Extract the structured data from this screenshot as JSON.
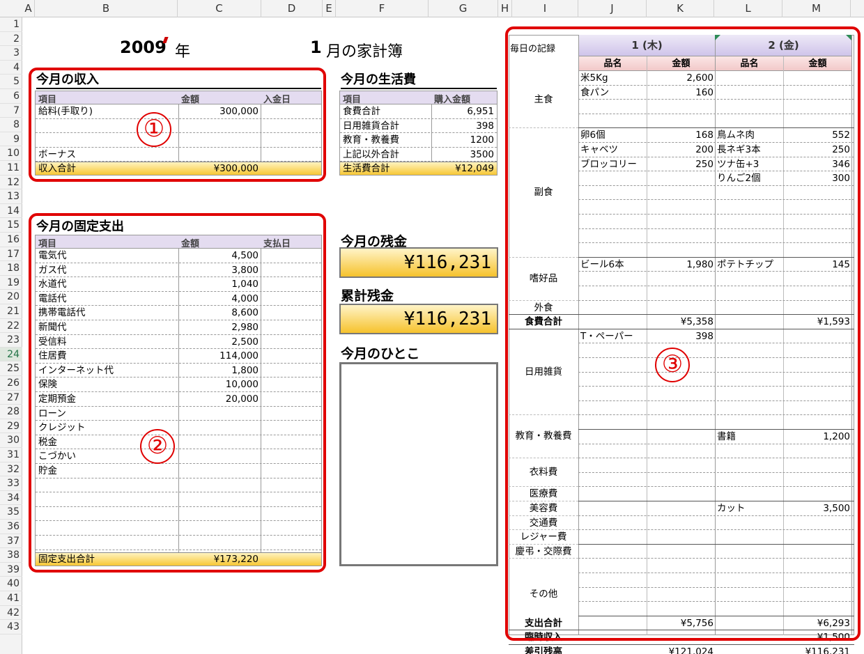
{
  "spreadsheet": {
    "columns": [
      "A",
      "B",
      "C",
      "D",
      "E",
      "F",
      "G",
      "H",
      "I",
      "J",
      "K",
      "L",
      "M"
    ],
    "rows": [
      "1",
      "2",
      "3",
      "4",
      "5",
      "6",
      "7",
      "8",
      "9",
      "10",
      "11",
      "12",
      "13",
      "14",
      "15",
      "16",
      "17",
      "18",
      "19",
      "20",
      "21",
      "22",
      "23",
      "24",
      "25",
      "26",
      "27",
      "28",
      "29",
      "30",
      "31",
      "32",
      "33",
      "34",
      "35",
      "36",
      "37",
      "38",
      "39",
      "40",
      "41",
      "42",
      "43"
    ],
    "selected_row": "24"
  },
  "title": {
    "year": "2009",
    "year_suffix": "年",
    "month": "1",
    "month_suffix": "月の家計簿"
  },
  "income": {
    "title": "今月の収入",
    "headers": [
      "項目",
      "金額",
      "入金日"
    ],
    "rows": [
      {
        "item": "給料(手取り)",
        "amount": "300,000"
      },
      {
        "item": "",
        "amount": ""
      },
      {
        "item": "",
        "amount": ""
      },
      {
        "item": "ボーナス",
        "amount": ""
      }
    ],
    "total_label": "収入合計",
    "total_value": "¥300,000"
  },
  "living": {
    "title": "今月の生活費",
    "headers": [
      "項目",
      "購入金額"
    ],
    "rows": [
      {
        "item": "食費合計",
        "amount": "6,951"
      },
      {
        "item": "日用雑貨合計",
        "amount": "398"
      },
      {
        "item": "教育・教養費",
        "amount": "1200"
      },
      {
        "item": "上記以外合計",
        "amount": "3500"
      }
    ],
    "total_label": "生活費合計",
    "total_value": "¥12,049"
  },
  "fixed": {
    "title": "今月の固定支出",
    "headers": [
      "項目",
      "金額",
      "支払日"
    ],
    "rows": [
      {
        "item": "電気代",
        "amount": "4,500"
      },
      {
        "item": "ガス代",
        "amount": "3,800"
      },
      {
        "item": "水道代",
        "amount": "1,040"
      },
      {
        "item": "電話代",
        "amount": "4,000"
      },
      {
        "item": "携帯電話代",
        "amount": "8,600"
      },
      {
        "item": "新聞代",
        "amount": "2,980"
      },
      {
        "item": "受信料",
        "amount": "2,500"
      },
      {
        "item": "住居費",
        "amount": "114,000"
      },
      {
        "item": "インターネット代",
        "amount": "1,800"
      },
      {
        "item": "保険",
        "amount": "10,000"
      },
      {
        "item": "定期預金",
        "amount": "20,000"
      },
      {
        "item": "ローン",
        "amount": ""
      },
      {
        "item": "クレジット",
        "amount": ""
      },
      {
        "item": "税金",
        "amount": ""
      },
      {
        "item": "こづかい",
        "amount": ""
      },
      {
        "item": "貯金",
        "amount": ""
      },
      {
        "item": "",
        "amount": ""
      },
      {
        "item": "",
        "amount": ""
      },
      {
        "item": "",
        "amount": ""
      },
      {
        "item": "",
        "amount": ""
      },
      {
        "item": "",
        "amount": ""
      }
    ],
    "total_label": "固定支出合計",
    "total_value": "¥173,220"
  },
  "balance": {
    "month_title": "今月の残金",
    "month_value": "¥116,231",
    "cumulative_title": "累計残金",
    "cumulative_value": "¥116,231",
    "comment_title": "今月のひとこ"
  },
  "daily": {
    "title": "毎日の記録",
    "days": [
      "1 (木)",
      "2 (金)"
    ],
    "sub_headers": [
      "品名",
      "金額",
      "品名",
      "金額"
    ],
    "categories": [
      "主食",
      "副食",
      "嗜好品",
      "外食",
      "食費合計",
      "日用雑貨",
      "教育・教養費",
      "衣料費",
      "医療費",
      "美容費",
      "交通費",
      "レジャー費",
      "慶弔・交際費",
      "その他",
      "支出合計",
      "臨時収入",
      "差引残高"
    ],
    "entries": [
      {
        "r": 0,
        "n1": "米5Kg",
        "a1": "2,600",
        "n2": "",
        "a2": ""
      },
      {
        "r": 1,
        "n1": "食パン",
        "a1": "160",
        "n2": "",
        "a2": ""
      },
      {
        "r": 4,
        "n1": "卵6個",
        "a1": "168",
        "n2": "鳥ムネ肉",
        "a2": "552"
      },
      {
        "r": 5,
        "n1": "キャベツ",
        "a1": "200",
        "n2": "長ネギ3本",
        "a2": "250"
      },
      {
        "r": 6,
        "n1": "ブロッコリー",
        "a1": "250",
        "n2": "ツナ缶+3",
        "a2": "346"
      },
      {
        "r": 7,
        "n1": "",
        "a1": "",
        "n2": "りんご2個",
        "a2": "300"
      },
      {
        "r": 13,
        "n1": "ビール6本",
        "a1": "1,980",
        "n2": "ポテトチップ",
        "a2": "145"
      },
      {
        "r": 17,
        "n1": "",
        "a1": "¥5,358",
        "n2": "",
        "a2": "¥1,593"
      },
      {
        "r": 18,
        "n1": "T・ペーパー",
        "a1": "398",
        "n2": "",
        "a2": ""
      },
      {
        "r": 25,
        "n1": "",
        "a1": "",
        "n2": "書籍",
        "a2": "1,200"
      },
      {
        "r": 30,
        "n1": "",
        "a1": "",
        "n2": "カット",
        "a2": "3,500"
      },
      {
        "r": 38,
        "n1": "",
        "a1": "¥5,756",
        "n2": "",
        "a2": "¥6,293"
      },
      {
        "r": 39,
        "n1": "",
        "a1": "",
        "n2": "",
        "a2": "¥1,500"
      },
      {
        "r": 40,
        "n1": "",
        "a1": "¥121,024",
        "n2": "",
        "a2": "¥116,231"
      }
    ]
  },
  "annotations": [
    "①",
    "②",
    "③"
  ],
  "colors": {
    "red": "#e00000",
    "header_purple": "#e4dcf0",
    "total_yellow": "#f7c734",
    "day_header": "#d8cfee",
    "sub_header_pink": "#f6d6d6"
  }
}
